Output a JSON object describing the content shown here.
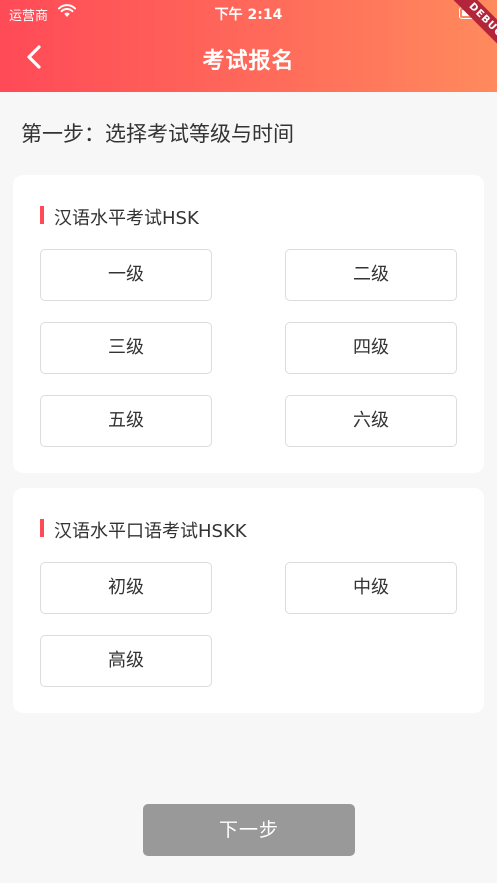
{
  "status_bar": {
    "carrier": "运营商",
    "time": "下午 2:14"
  },
  "header": {
    "title": "考试报名",
    "debug_label": "DEBUG"
  },
  "step": {
    "title": "第一步：选择考试等级与时间"
  },
  "sections": [
    {
      "title": "汉语水平考试HSK",
      "levels": [
        "一级",
        "二级",
        "三级",
        "四级",
        "五级",
        "六级"
      ]
    },
    {
      "title": "汉语水平口语考试HSKK",
      "levels": [
        "初级",
        "中级",
        "高级"
      ]
    }
  ],
  "next_button": {
    "label": "下一步"
  },
  "colors": {
    "header_start": "#ff4a57",
    "header_end": "#ff8a5d",
    "accent": "#ff4a57",
    "disabled_button": "#999999"
  },
  "icons": {
    "back": "chevron-left-icon",
    "wifi": "wifi-icon",
    "battery": "battery-icon"
  }
}
